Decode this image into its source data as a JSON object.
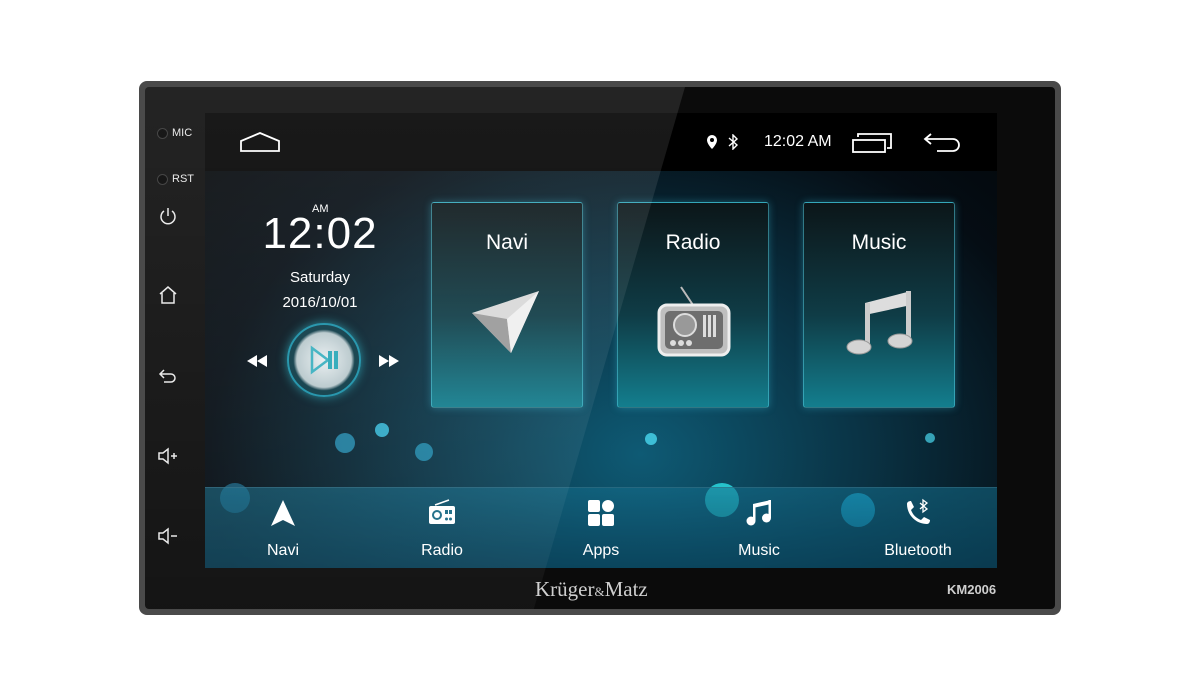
{
  "hardware": {
    "mic_label": "MIC",
    "rst_label": "RST",
    "buttons": [
      "power-icon",
      "home-icon",
      "back-icon",
      "volume-up-icon",
      "volume-down-icon"
    ]
  },
  "status_bar": {
    "time": "12:02 AM",
    "icons": [
      "home-icon",
      "location-icon",
      "bluetooth-icon",
      "recent-apps-icon",
      "back-icon"
    ]
  },
  "clock_widget": {
    "meridiem": "AM",
    "time": "12:02",
    "day": "Saturday",
    "date": "2016/10/01"
  },
  "tiles": [
    {
      "label": "Navi",
      "icon": "navigation-arrow-icon"
    },
    {
      "label": "Radio",
      "icon": "radio-icon"
    },
    {
      "label": "Music",
      "icon": "music-note-icon"
    }
  ],
  "dock": [
    {
      "label": "Navi",
      "icon": "navigation-icon"
    },
    {
      "label": "Radio",
      "icon": "radio-icon"
    },
    {
      "label": "Apps",
      "icon": "apps-grid-icon"
    },
    {
      "label": "Music",
      "icon": "music-icon"
    },
    {
      "label": "Bluetooth",
      "icon": "bluetooth-phone-icon"
    }
  ],
  "branding": {
    "brand_main": "Krüger",
    "brand_amp": "&",
    "brand_end": "Matz",
    "model": "KM2006"
  },
  "colors": {
    "accent": "#28c8dc",
    "bezel": "#0b0b0b"
  }
}
